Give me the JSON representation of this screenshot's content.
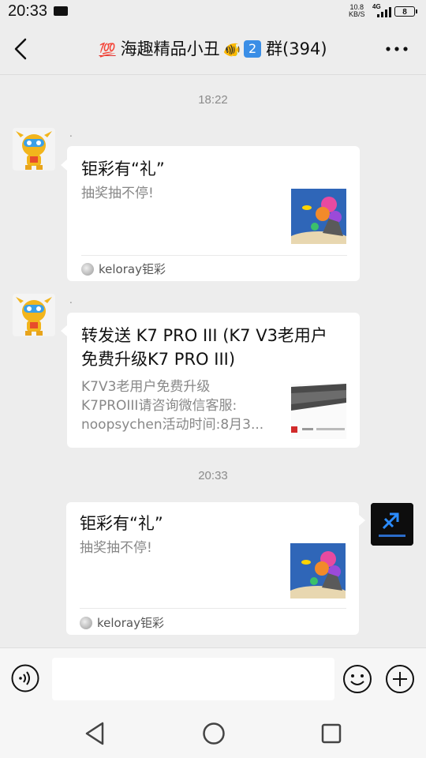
{
  "status_bar": {
    "time": "20:33",
    "speed_value": "10.8",
    "speed_unit": "KB/S",
    "network": "4G",
    "battery": "8"
  },
  "header": {
    "hundred_emoji": "💯",
    "title_main": "海趣精品小丑",
    "fish_emoji": "🐠",
    "number_badge": "2",
    "title_tail": "群(394)"
  },
  "messages": [
    {
      "timestamp": "18:22",
      "sender": ".",
      "title": "钜彩有“礼”",
      "description": "抽奖抽不停!",
      "source": "keloray钜彩"
    },
    {
      "sender": ".",
      "title_line1": "转发送 K7 PRO III (K7 V3老用户",
      "title_line2": "免费升级K7 PRO III)",
      "desc_line1": "K7V3老用户免费升级",
      "desc_line2": "K7PROIII请咨询微信客服:",
      "desc_line3": "noopsychen活动时间:8月3..."
    },
    {
      "timestamp": "20:33",
      "title": "钜彩有“礼”",
      "description": "抽奖抽不停!",
      "source": "keloray钜彩"
    }
  ],
  "input": {
    "placeholder": ""
  },
  "colors": {
    "background": "#ededed",
    "card": "#ffffff",
    "muted": "#888888"
  }
}
